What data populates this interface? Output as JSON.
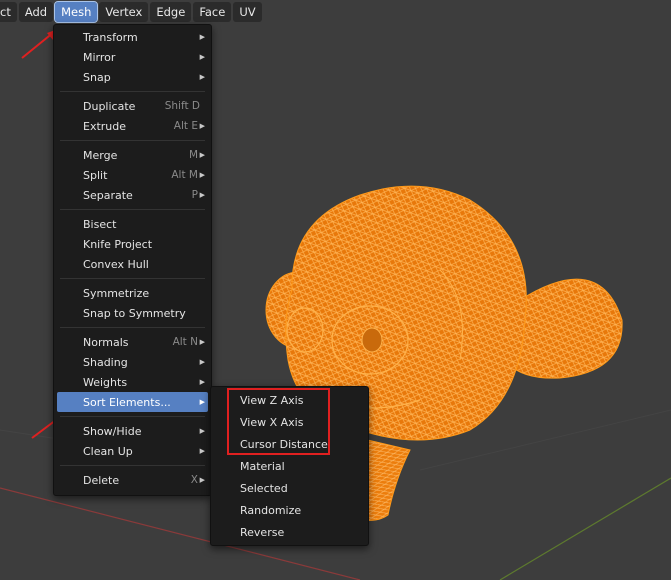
{
  "menubar": {
    "items": [
      {
        "label": "ct"
      },
      {
        "label": "Add"
      },
      {
        "label": "Mesh"
      },
      {
        "label": "Vertex"
      },
      {
        "label": "Edge"
      },
      {
        "label": "Face"
      },
      {
        "label": "UV"
      }
    ]
  },
  "mesh_menu": {
    "transform": {
      "label": "Transform"
    },
    "mirror": {
      "label": "Mirror"
    },
    "snap": {
      "label": "Snap"
    },
    "duplicate": {
      "label": "Duplicate",
      "shortcut": "Shift D"
    },
    "extrude": {
      "label": "Extrude",
      "shortcut": "Alt E"
    },
    "merge": {
      "label": "Merge",
      "shortcut": "M"
    },
    "split": {
      "label": "Split",
      "shortcut": "Alt M"
    },
    "separate": {
      "label": "Separate",
      "shortcut": "P"
    },
    "bisect": {
      "label": "Bisect"
    },
    "knife_project": {
      "label": "Knife Project"
    },
    "convex_hull": {
      "label": "Convex Hull"
    },
    "symmetrize": {
      "label": "Symmetrize"
    },
    "snap_to_symmetry": {
      "label": "Snap to Symmetry"
    },
    "normals": {
      "label": "Normals",
      "shortcut": "Alt N"
    },
    "shading": {
      "label": "Shading"
    },
    "weights": {
      "label": "Weights"
    },
    "sort_elements": {
      "label": "Sort Elements..."
    },
    "show_hide": {
      "label": "Show/Hide"
    },
    "clean_up": {
      "label": "Clean Up"
    },
    "delete": {
      "label": "Delete",
      "shortcut": "X"
    }
  },
  "sort_menu": {
    "items": [
      {
        "label": "View Z Axis"
      },
      {
        "label": "View X Axis"
      },
      {
        "label": "Cursor Distance"
      },
      {
        "label": "Material"
      },
      {
        "label": "Selected"
      },
      {
        "label": "Randomize"
      },
      {
        "label": "Reverse"
      }
    ]
  },
  "colors": {
    "viewport_bg": "#3d3d3d",
    "highlight": "#5680c2",
    "wireframe": "#ff8c00",
    "annotation": "#e02020"
  }
}
